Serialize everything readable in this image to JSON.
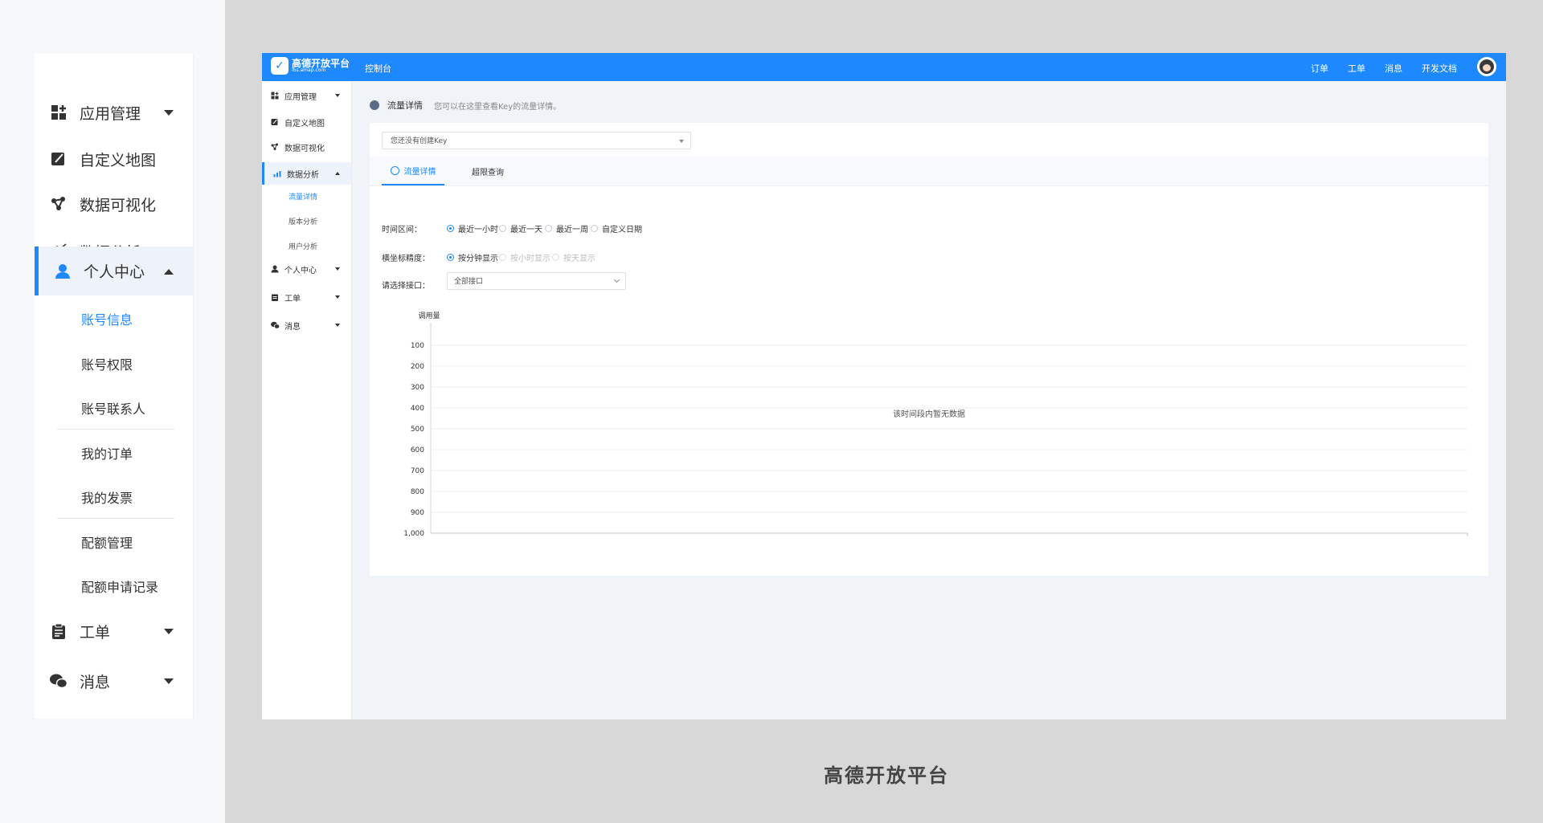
{
  "big_sidebar": {
    "items": [
      {
        "label": "应用管理",
        "icon": "grid-plus-icon",
        "caret": "down"
      },
      {
        "label": "自定义地图",
        "icon": "map-brush-icon",
        "caret": ""
      },
      {
        "label": "数据可视化",
        "icon": "nodes-icon",
        "caret": ""
      },
      {
        "label": "数据分析",
        "icon": "bar-chart-icon",
        "caret": "down"
      },
      {
        "label": "个人中心",
        "icon": "user-icon",
        "caret": "up",
        "active": true
      },
      {
        "label": "工单",
        "icon": "clipboard-icon",
        "caret": "down"
      },
      {
        "label": "消息",
        "icon": "chat-icon",
        "caret": "down"
      }
    ],
    "sub_items": [
      "账号信息",
      "账号权限",
      "账号联系人",
      "我的订单",
      "我的发票",
      "配额管理",
      "配额申请记录"
    ]
  },
  "topbar": {
    "logo_cn": "高德开放平台",
    "logo_en": "lbs.amap.com",
    "console": "控制台",
    "links": [
      "订单",
      "工单",
      "消息",
      "开发文档"
    ]
  },
  "small_sidebar": {
    "items": [
      {
        "label": "应用管理",
        "icon": "grid-plus-icon",
        "caret": "down"
      },
      {
        "label": "自定义地图",
        "icon": "map-brush-icon",
        "caret": ""
      },
      {
        "label": "数据可视化",
        "icon": "nodes-icon",
        "caret": ""
      },
      {
        "label": "数据分析",
        "icon": "bar-chart-icon",
        "caret": "up",
        "active": true
      },
      {
        "label": "个人中心",
        "icon": "user-icon",
        "caret": "down"
      },
      {
        "label": "工单",
        "icon": "clipboard-icon",
        "caret": "down"
      },
      {
        "label": "消息",
        "icon": "chat-icon",
        "caret": "down"
      }
    ],
    "sub_items": [
      "流量详情",
      "版本分析",
      "用户分析"
    ]
  },
  "main": {
    "title": "流量详情",
    "description": "您可以在这里查看Key的流量详情。",
    "key_select": "您还没有创建Key",
    "tabs": [
      "流量详情",
      "超限查询"
    ],
    "time_label": "时间区间：",
    "time_options": [
      "最近一小时",
      "最近一天",
      "最近一周",
      "自定义日期"
    ],
    "precision_label": "横坐标精度：",
    "precision_options": [
      "按分钟显示",
      "按小时显示",
      "按天显示"
    ],
    "api_label": "请选择接口：",
    "api_select": "全部接口"
  },
  "chart_data": {
    "type": "line",
    "ylabel": "调用量",
    "y_ticks": [
      "100",
      "200",
      "300",
      "400",
      "500",
      "600",
      "700",
      "800",
      "900",
      "1,000"
    ],
    "series": [],
    "empty_text": "该时间段内暂无数据",
    "grid": true
  },
  "caption": "高德开放平台",
  "colors": {
    "accent": "#1e88ff",
    "background": "#d8d8d8"
  }
}
